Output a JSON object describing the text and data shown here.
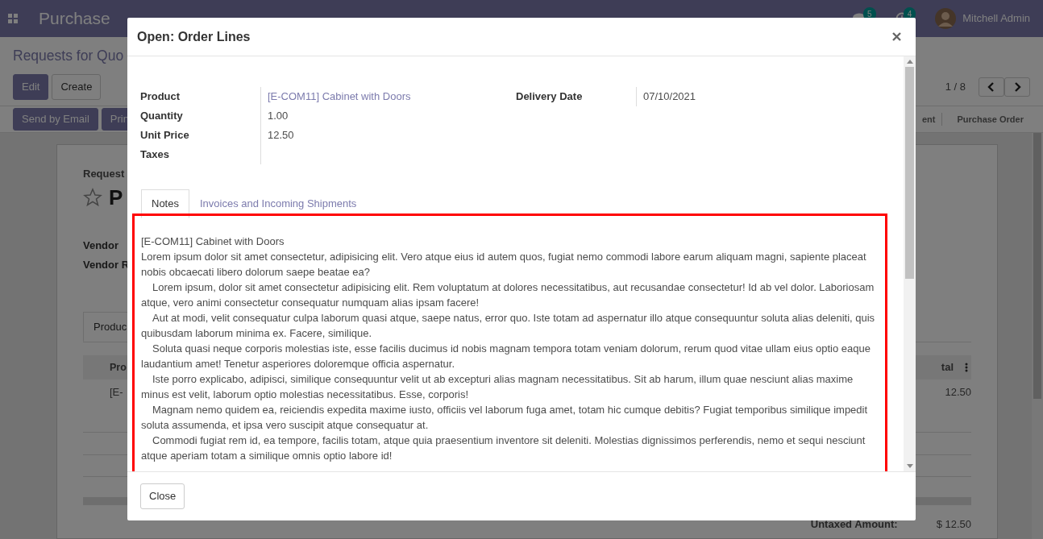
{
  "navbar": {
    "app_title": "Purchase",
    "messages_badge": "5",
    "activities_badge": "4",
    "user": "Mitchell Admin"
  },
  "breadcrumb": "Requests for Quo",
  "actions": [
    "Edit",
    "Create"
  ],
  "pager": "1 / 8",
  "form_buttons": [
    "Send by Email",
    "Prin"
  ],
  "statusbar": [
    {
      "label": "ent",
      "selected": false
    },
    {
      "label": "Purchase Order",
      "selected": false
    }
  ],
  "sheet": {
    "label": "Request",
    "title": "P",
    "starred": false,
    "fields": [
      "Vendor",
      "Vendor R"
    ],
    "tabs": [
      {
        "label": "Produc",
        "selected": true
      }
    ],
    "table": {
      "columns": [
        "Pro",
        "tal"
      ],
      "rows": [
        [
          "[E-",
          "12.50"
        ]
      ]
    },
    "totals": [
      {
        "label": "Untaxed Amount:",
        "value": "$ 12.50"
      }
    ]
  },
  "dialog": {
    "title": "Open: Order Lines",
    "fields_left": [
      {
        "label": "Product",
        "value": "[E-COM11] Cabinet with Doors",
        "kind": "link"
      },
      {
        "label": "Quantity",
        "value": "1.00",
        "kind": "text"
      },
      {
        "label": "Unit Price",
        "value": "12.50",
        "kind": "text"
      },
      {
        "label": "Taxes",
        "kind": "text"
      }
    ],
    "fields_right": [
      {
        "label": "Delivery Date",
        "value": "07/10/2021",
        "kind": "text"
      }
    ],
    "tabs": [
      {
        "label": "Notes",
        "selected": true
      },
      {
        "label": "Invoices and Incoming Shipments",
        "selected": false
      }
    ],
    "notes": [
      {
        "text": "[E-COM11] Cabinet with Doors",
        "indented": false
      },
      {
        "text": "Lorem ipsum dolor sit amet consectetur, adipisicing elit. Vero atque eius id autem quos, fugiat nemo commodi labore earum aliquam magni, sapiente placeat nobis obcaecati libero dolorum saepe beatae ea?",
        "indented": false
      },
      {
        "text": "Lorem ipsum, dolor sit amet consectetur adipisicing elit. Rem voluptatum at dolores necessitatibus, aut recusandae consectetur! Id ab vel dolor. Laboriosam atque, vero animi consectetur consequatur numquam alias ipsam facere!",
        "indented": true
      },
      {
        "text": "Aut at modi, velit consequatur culpa laborum quasi atque, saepe natus, error quo. Iste totam ad aspernatur illo atque consequuntur soluta alias deleniti, quis quibusdam laborum minima ex. Facere, similique.",
        "indented": true
      },
      {
        "text": "Soluta quasi neque corporis molestias iste, esse facilis ducimus id nobis magnam tempora totam veniam dolorum, rerum quod vitae ullam eius optio eaque laudantium amet! Tenetur asperiores doloremque officia aspernatur.",
        "indented": true
      },
      {
        "text": "Iste porro explicabo, adipisci, similique consequuntur velit ut ab excepturi alias magnam necessitatibus. Sit ab harum, illum quae nesciunt alias maxime minus est velit, laborum optio molestias necessitatibus. Esse, corporis!",
        "indented": true
      },
      {
        "text": "Magnam nemo quidem ea, reiciendis expedita maxime iusto, officiis vel laborum fuga amet, totam hic cumque debitis? Fugiat temporibus similique impedit soluta assumenda, et ipsa vero suscipit atque consequatur at.",
        "indented": true
      },
      {
        "text": "Commodi fugiat rem id, ea tempore, facilis totam, atque quia praesentium inventore sit deleniti. Molestias dignissimos perferendis, nemo et sequi nesciunt atque aperiam totam a similique omnis optio labore id!",
        "indented": true
      }
    ],
    "footer_buttons": [
      "Close"
    ]
  }
}
